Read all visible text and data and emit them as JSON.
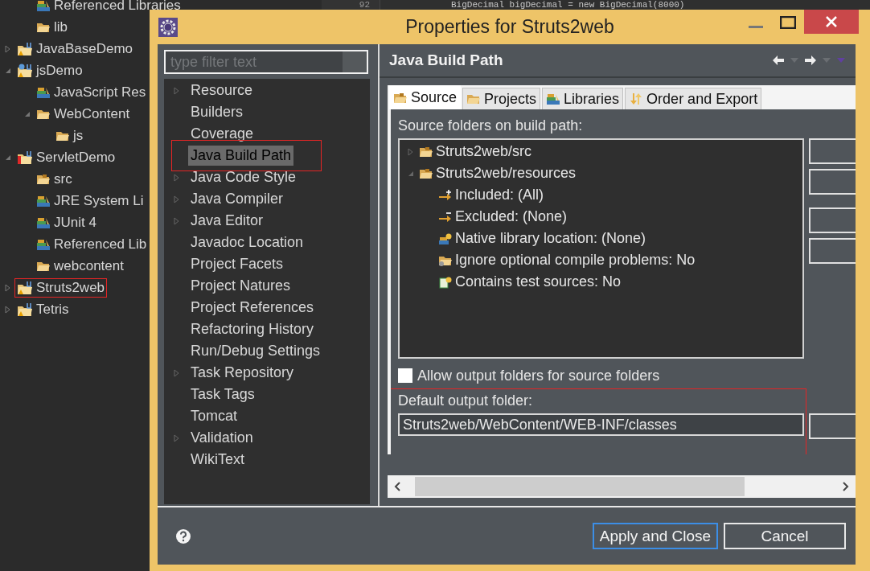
{
  "explorer": {
    "continued_items": [
      {
        "label": "Referenced Libraries",
        "kind": "library",
        "marked": false
      },
      {
        "label": "lib",
        "kind": "folder",
        "marked": false
      }
    ],
    "items": [
      {
        "label": "JavaBaseDemo",
        "kind": "project",
        "expanded": false,
        "marked": false
      },
      {
        "label": "jsDemo",
        "kind": "web-project",
        "expanded": true,
        "marked": false,
        "children": [
          {
            "label": "JavaScript Res",
            "kind": "library",
            "marked": false
          },
          {
            "label": "WebContent",
            "kind": "folder",
            "expanded": true,
            "marked": false,
            "children": [
              {
                "label": "js",
                "kind": "folder",
                "marked": false
              }
            ]
          }
        ]
      },
      {
        "label": "ServletDemo",
        "kind": "error-project",
        "expanded": true,
        "marked": false,
        "children": [
          {
            "label": "src",
            "kind": "package-folder",
            "marked": false
          },
          {
            "label": "JRE System Li",
            "kind": "library",
            "marked": false
          },
          {
            "label": "JUnit 4",
            "kind": "library",
            "marked": false
          },
          {
            "label": "Referenced Lib",
            "kind": "library",
            "marked": false
          },
          {
            "label": "webcontent",
            "kind": "folder",
            "marked": false
          }
        ]
      },
      {
        "label": "Struts2web",
        "kind": "project",
        "expanded": false,
        "marked": true
      },
      {
        "label": "Tetris",
        "kind": "project",
        "expanded": false,
        "marked": false
      }
    ]
  },
  "editor": {
    "line_number": "92",
    "code": "BigDecimal bigDecimal = new BigDecimal(8000)"
  },
  "dialog": {
    "title": "Properties for Struts2web",
    "filter": {
      "placeholder": "type filter text"
    },
    "pages": [
      {
        "label": "Resource",
        "has_children": true,
        "selected": false,
        "marked": false
      },
      {
        "label": "Builders",
        "has_children": false,
        "selected": false,
        "marked": false
      },
      {
        "label": "Coverage",
        "has_children": false,
        "selected": false,
        "marked": false
      },
      {
        "label": "Java Build Path",
        "has_children": false,
        "selected": true,
        "marked": true
      },
      {
        "label": "Java Code Style",
        "has_children": true,
        "selected": false,
        "marked": false
      },
      {
        "label": "Java Compiler",
        "has_children": true,
        "selected": false,
        "marked": false
      },
      {
        "label": "Java Editor",
        "has_children": true,
        "selected": false,
        "marked": false
      },
      {
        "label": "Javadoc Location",
        "has_children": false,
        "selected": false,
        "marked": false
      },
      {
        "label": "Project Facets",
        "has_children": false,
        "selected": false,
        "marked": false
      },
      {
        "label": "Project Natures",
        "has_children": false,
        "selected": false,
        "marked": false
      },
      {
        "label": "Project References",
        "has_children": false,
        "selected": false,
        "marked": false
      },
      {
        "label": "Refactoring History",
        "has_children": false,
        "selected": false,
        "marked": false
      },
      {
        "label": "Run/Debug Settings",
        "has_children": false,
        "selected": false,
        "marked": false
      },
      {
        "label": "Task Repository",
        "has_children": true,
        "selected": false,
        "marked": false
      },
      {
        "label": "Task Tags",
        "has_children": false,
        "selected": false,
        "marked": false
      },
      {
        "label": "Tomcat",
        "has_children": false,
        "selected": false,
        "marked": false
      },
      {
        "label": "Validation",
        "has_children": true,
        "selected": false,
        "marked": false
      },
      {
        "label": "WikiText",
        "has_children": false,
        "selected": false,
        "marked": false
      }
    ],
    "page_title": "Java Build Path",
    "tabs": [
      {
        "label": "Source",
        "kind": "package-folder",
        "selected": true
      },
      {
        "label": "Projects",
        "kind": "folder",
        "selected": false
      },
      {
        "label": "Libraries",
        "kind": "library",
        "selected": false
      },
      {
        "label": "Order and Export",
        "kind": "order",
        "selected": false
      }
    ],
    "source_label": "Source folders on build path:",
    "source_tree": [
      {
        "label": "Struts2web/src",
        "kind": "package-folder",
        "expanded": false
      },
      {
        "label": "Struts2web/resources",
        "kind": "package-folder",
        "expanded": true,
        "children": [
          {
            "label": "Included: (All)",
            "kind": "included"
          },
          {
            "label": "Excluded: (None)",
            "kind": "excluded"
          },
          {
            "label": "Native library location: (None)",
            "kind": "native"
          },
          {
            "label": "Ignore optional compile problems: No",
            "kind": "ignore"
          },
          {
            "label": "Contains test sources: No",
            "kind": "test"
          }
        ]
      }
    ],
    "side_buttons": [
      {
        "kind": "button"
      },
      {
        "kind": "button"
      },
      {
        "kind": "spaced-button"
      },
      {
        "kind": "button"
      }
    ],
    "allow_output": {
      "label": "Allow output folders for source folders",
      "checked": false
    },
    "output": {
      "label": "Default output folder:",
      "value": "Struts2web/WebContent/WEB-INF/classes",
      "marked": true
    },
    "buttons": [
      {
        "label": "Apply and Close",
        "default": true
      },
      {
        "label": "Cancel",
        "default": false
      }
    ]
  }
}
